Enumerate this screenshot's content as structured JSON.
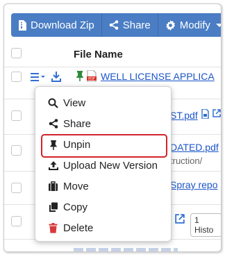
{
  "toolbar": {
    "download_zip": "Download Zip",
    "share": "Share",
    "modify": "Modify"
  },
  "table": {
    "column_file_name": "File Name",
    "rows": [
      {
        "link": "WELL LICENSE APPLICA"
      },
      {
        "link": "ST.pdf"
      },
      {
        "link": "DATED.pdf",
        "sub": "truction/"
      },
      {
        "link": "Spray repo"
      },
      {
        "pill": "1 Histo"
      }
    ]
  },
  "menu": {
    "items": [
      {
        "label": "View",
        "icon": "search-icon"
      },
      {
        "label": "Share",
        "icon": "share-icon"
      },
      {
        "label": "Unpin",
        "icon": "pin-icon"
      },
      {
        "label": "Upload New Version",
        "icon": "upload-icon"
      },
      {
        "label": "Move",
        "icon": "suitcase-icon"
      },
      {
        "label": "Copy",
        "icon": "copy-icon"
      },
      {
        "label": "Delete",
        "icon": "trash-icon"
      }
    ]
  },
  "colors": {
    "primary": "#4a7dc4",
    "link": "#1a55c9",
    "highlight": "#d2232a",
    "pin_green": "#2e8b3a",
    "trash_red": "#d63a3a"
  }
}
